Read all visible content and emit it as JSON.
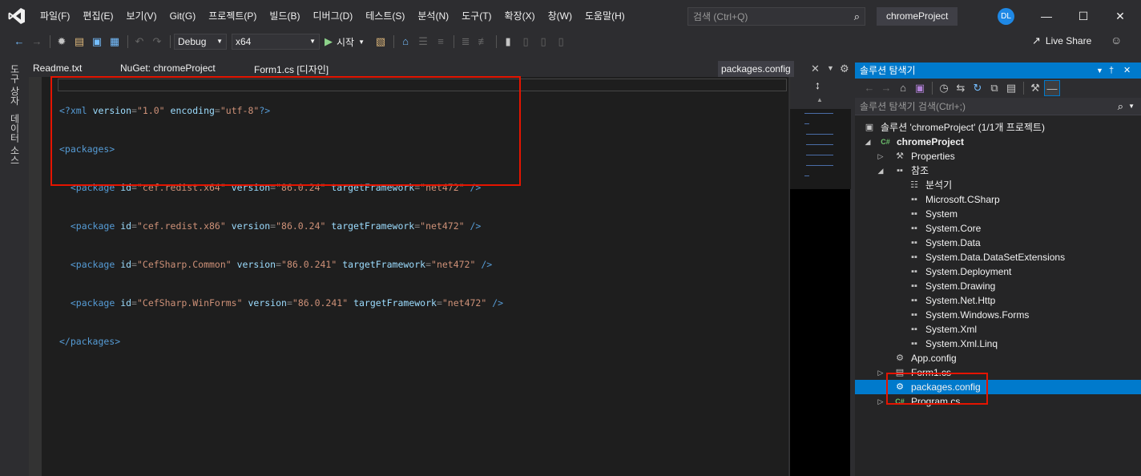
{
  "menu": {
    "items": [
      "파일(F)",
      "편집(E)",
      "보기(V)",
      "Git(G)",
      "프로젝트(P)",
      "빌드(B)",
      "디버그(D)",
      "테스트(S)",
      "분석(N)",
      "도구(T)",
      "확장(X)",
      "창(W)",
      "도움말(H)"
    ],
    "search_placeholder": "검색 (Ctrl+Q)",
    "project_name": "chromeProject",
    "user_initials": "DL"
  },
  "toolbar": {
    "configuration": "Debug",
    "platform": "x64",
    "start_label": "시작",
    "live_share": "Live Share"
  },
  "left_tabs": [
    "도구 상자",
    "데이터 소스"
  ],
  "doc_tabs": {
    "tab1": "Readme.txt",
    "tab2": "NuGet: chromeProject",
    "tab3": "Form1.cs [디자인]",
    "active": "packages.config"
  },
  "code": {
    "line1": {
      "decl": "<?xml",
      "a1": "version",
      "v1": "\"1.0\"",
      "a2": "encoding",
      "v2": "\"utf-8\"",
      "end": "?>"
    },
    "open_tag": "<packages>",
    "packages": [
      {
        "id": "\"cef.redist.x64\"",
        "version": "\"86.0.24\"",
        "fw": "\"net472\""
      },
      {
        "id": "\"cef.redist.x86\"",
        "version": "\"86.0.24\"",
        "fw": "\"net472\""
      },
      {
        "id": "\"CefSharp.Common\"",
        "version": "\"86.0.241\"",
        "fw": "\"net472\""
      },
      {
        "id": "\"CefSharp.WinForms\"",
        "version": "\"86.0.241\"",
        "fw": "\"net472\""
      }
    ],
    "pkg_tag": "<package",
    "attr_id": "id",
    "attr_version": "version",
    "attr_fw": "targetFramework",
    "self_close": "/>",
    "close_tag": "</packages>"
  },
  "solution_explorer": {
    "title": "솔루션 탐색기",
    "search_placeholder": "솔루션 탐색기 검색(Ctrl+;)",
    "solution": "솔루션 'chromeProject' (1/1개 프로젝트)",
    "project": "chromeProject",
    "properties": "Properties",
    "references": "참조",
    "ref_items": [
      "분석기",
      "Microsoft.CSharp",
      "System",
      "System.Core",
      "System.Data",
      "System.Data.DataSetExtensions",
      "System.Deployment",
      "System.Drawing",
      "System.Net.Http",
      "System.Windows.Forms",
      "System.Xml",
      "System.Xml.Linq"
    ],
    "app_config": "App.config",
    "form1": "Form1.cs",
    "packages_config": "packages.config",
    "program": "Program.cs"
  },
  "colors": {
    "accent": "#007acc",
    "highlight_box": "#e51400"
  }
}
